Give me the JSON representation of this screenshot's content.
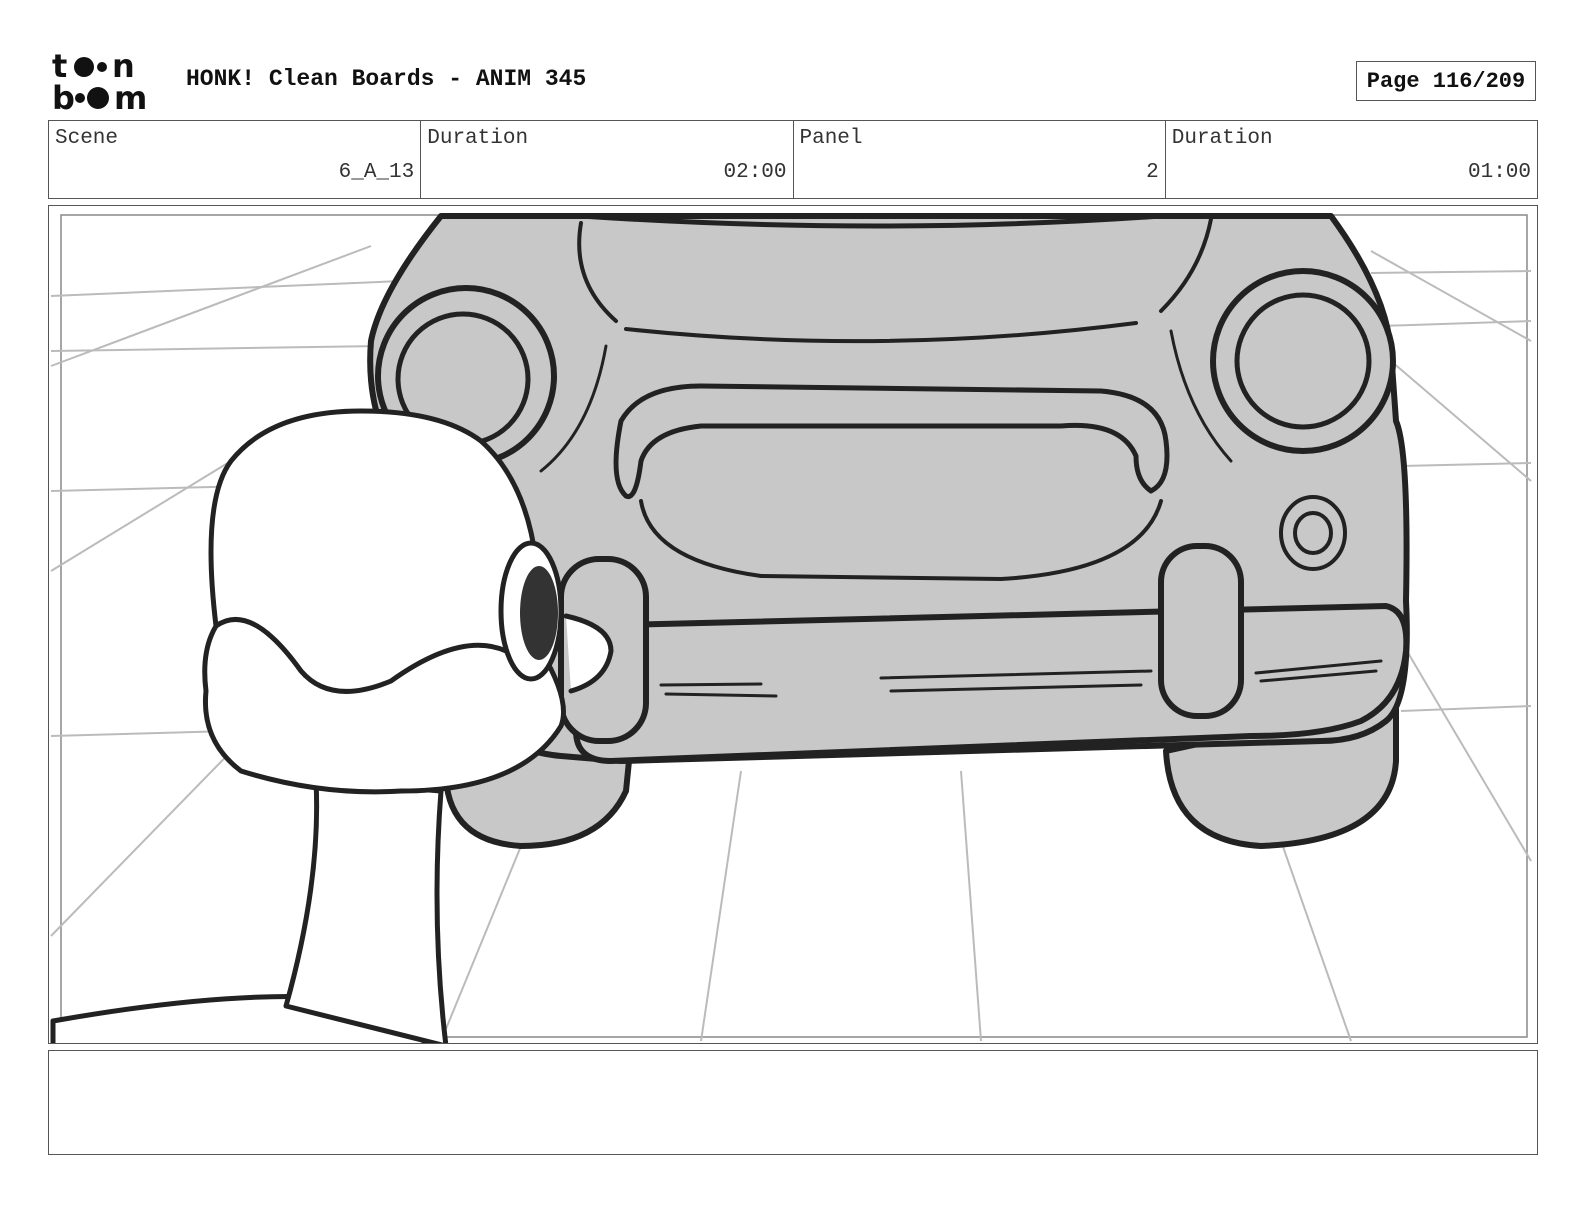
{
  "header": {
    "logo_text": "toon boom",
    "title": "HONK! Clean Boards - ANIM 345",
    "page": "Page 116/209"
  },
  "info": {
    "scene_label": "Scene",
    "scene_value": "6_A_13",
    "scene_duration_label": "Duration",
    "scene_duration_value": "02:00",
    "panel_label": "Panel",
    "panel_value": "2",
    "panel_duration_label": "Duration",
    "panel_duration_value": "01:00"
  },
  "panel": {
    "image": "storyboard-sketch-car-and-goose",
    "car_fill": "#c8c8c8",
    "line_color": "#222222",
    "grid_color": "#bbbbbb"
  },
  "notes": {
    "text": ""
  }
}
